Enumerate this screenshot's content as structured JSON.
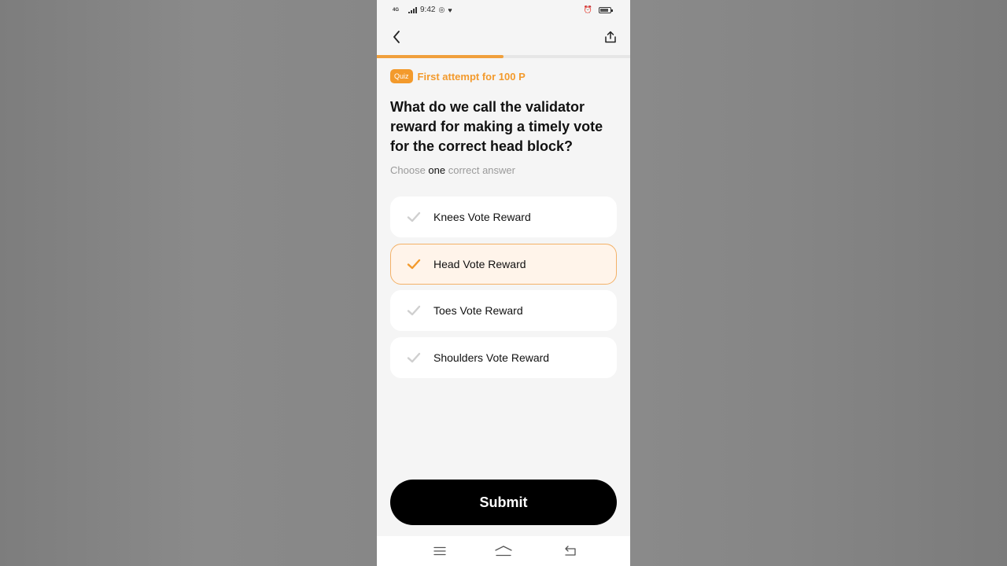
{
  "status_bar": {
    "network": "4G",
    "time": "9:42",
    "icons": [
      "network-icon",
      "signal-icon",
      "notification-icon",
      "alarm-icon",
      "battery-icon"
    ]
  },
  "header": {
    "back_icon": "chevron-left-icon",
    "share_icon": "share-icon"
  },
  "progress": {
    "fraction": 0.5,
    "color": "#f0a03c"
  },
  "quiz": {
    "badge": "Quiz",
    "reward": "First attempt for 100 P"
  },
  "question": "What do we call the validator reward for making a timely vote for the correct head block?",
  "instruction": {
    "prefix": "Choose ",
    "emphasis": "one",
    "suffix": " correct answer"
  },
  "options": [
    {
      "label": "Knees Vote Reward",
      "selected": false
    },
    {
      "label": "Head Vote Reward",
      "selected": true
    },
    {
      "label": "Toes Vote Reward",
      "selected": false
    },
    {
      "label": "Shoulders Vote Reward",
      "selected": false
    }
  ],
  "submit": {
    "label": "Submit"
  },
  "nav_bar": {
    "icons": [
      "menu-icon",
      "home-icon",
      "back-nav-icon"
    ]
  },
  "colors": {
    "accent": "#f39a2c",
    "selected_bg": "#fff4ea",
    "selected_border": "#f3b167",
    "unselected_check": "#cfcfcf"
  }
}
